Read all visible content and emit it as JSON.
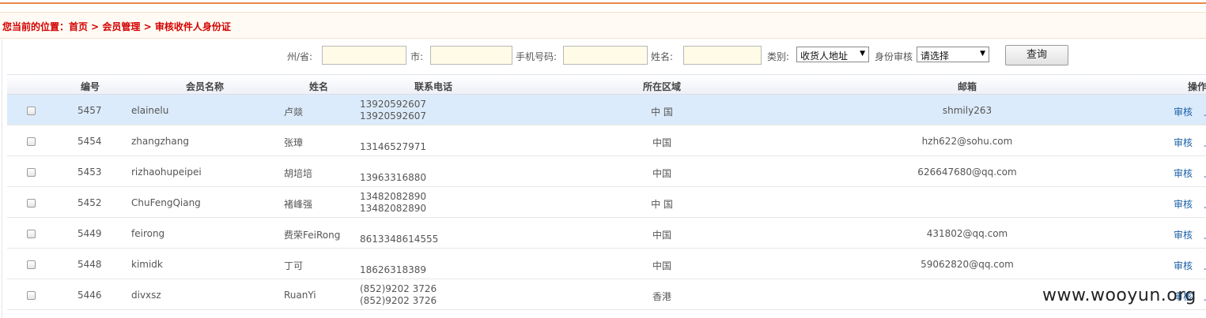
{
  "breadcrumb": "您当前的位置：首页 > 会员管理 > 审核收件人身份证",
  "filters": {
    "province_label": "州/省:",
    "province_value": "",
    "city_label": "市:",
    "city_value": "",
    "mobile_label": "手机号码:",
    "mobile_value": "",
    "name_label": "姓名:",
    "name_value": "",
    "category_label": "类别:",
    "category_selected": "收货人地址",
    "id_review_label": "身份审核",
    "id_review_selected": "请选择",
    "query_label": "查询"
  },
  "table": {
    "headers": {
      "id": "编号",
      "member": "会员名称",
      "name": "姓名",
      "phone": "联系电话",
      "region": "所在区域",
      "email": "邮箱",
      "action": "操作"
    },
    "rows": [
      {
        "id": "5457",
        "member": "elainelu",
        "name": "卢燚",
        "phone1": "13920592607",
        "phone2": "13920592607",
        "region": "中 国",
        "email": "shmily263",
        "action": "审核",
        "action2": "上"
      },
      {
        "id": "5454",
        "member": "zhangzhang",
        "name": "张璋",
        "phone1": "",
        "phone2": "13146527971",
        "region": "中国",
        "email": "hzh622@sohu.com",
        "action": "审核",
        "action2": "上"
      },
      {
        "id": "5453",
        "member": "rizhaohupeipei",
        "name": "胡培培",
        "phone1": "",
        "phone2": "13963316880",
        "region": "中国",
        "email": "626647680@qq.com",
        "action": "审核",
        "action2": "上"
      },
      {
        "id": "5452",
        "member": "ChuFengQiang",
        "name": "褚峰强",
        "phone1": "13482082890",
        "phone2": "13482082890",
        "region": "中 国",
        "email": "",
        "action": "审核",
        "action2": "上"
      },
      {
        "id": "5449",
        "member": "feirong",
        "name": "费荣FeiRong",
        "phone1": "",
        "phone2": "8613348614555",
        "region": "中国",
        "email": "431802@qq.com",
        "action": "审核",
        "action2": "上"
      },
      {
        "id": "5448",
        "member": "kimidk",
        "name": "丁可",
        "phone1": "",
        "phone2": "18626318389",
        "region": "中国",
        "email": "59062820@qq.com",
        "action": "审核",
        "action2": "上"
      },
      {
        "id": "5446",
        "member": "divxsz",
        "name": "RuanYi",
        "phone1": "(852)9202 3726",
        "phone2": "(852)9202 3726",
        "region": "香港",
        "email": "",
        "action": "审核",
        "action2": "上"
      }
    ]
  },
  "watermark": "www.wooyun.org"
}
